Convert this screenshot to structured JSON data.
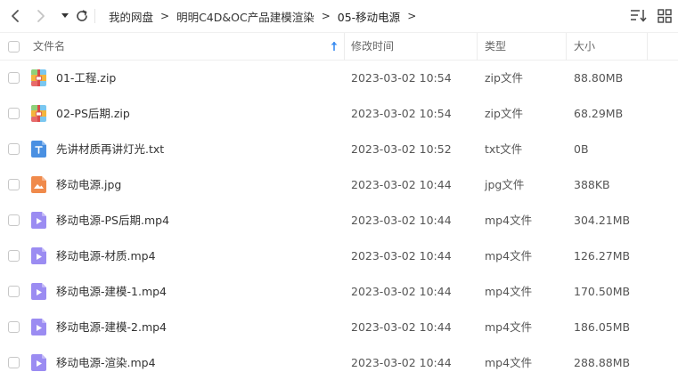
{
  "breadcrumbs": [
    "我的网盘",
    "明明C4D&OC产品建模渲染",
    "05-移动电源"
  ],
  "columns": {
    "name": "文件名",
    "modified": "修改时间",
    "type": "类型",
    "size": "大小"
  },
  "colors": {
    "zip": "#f5a623",
    "txt": "#4a90e2",
    "image": "#f08a4b",
    "video": "#9b8cf2"
  },
  "files": [
    {
      "name": "01-工程.zip",
      "modified": "2023-03-02 10:54",
      "type": "zip文件",
      "size": "88.80MB",
      "icon": "zip-icon"
    },
    {
      "name": "02-PS后期.zip",
      "modified": "2023-03-02 10:54",
      "type": "zip文件",
      "size": "68.29MB",
      "icon": "zip-icon"
    },
    {
      "name": "先讲材质再讲灯光.txt",
      "modified": "2023-03-02 10:52",
      "type": "txt文件",
      "size": "0B",
      "icon": "txt-icon"
    },
    {
      "name": "移动电源.jpg",
      "modified": "2023-03-02 10:44",
      "type": "jpg文件",
      "size": "388KB",
      "icon": "image-icon"
    },
    {
      "name": "移动电源-PS后期.mp4",
      "modified": "2023-03-02 10:44",
      "type": "mp4文件",
      "size": "304.21MB",
      "icon": "video-icon"
    },
    {
      "name": "移动电源-材质.mp4",
      "modified": "2023-03-02 10:44",
      "type": "mp4文件",
      "size": "126.27MB",
      "icon": "video-icon"
    },
    {
      "name": "移动电源-建模-1.mp4",
      "modified": "2023-03-02 10:44",
      "type": "mp4文件",
      "size": "170.50MB",
      "icon": "video-icon"
    },
    {
      "name": "移动电源-建模-2.mp4",
      "modified": "2023-03-02 10:44",
      "type": "mp4文件",
      "size": "186.05MB",
      "icon": "video-icon"
    },
    {
      "name": "移动电源-渲染.mp4",
      "modified": "2023-03-02 10:44",
      "type": "mp4文件",
      "size": "288.88MB",
      "icon": "video-icon"
    }
  ]
}
